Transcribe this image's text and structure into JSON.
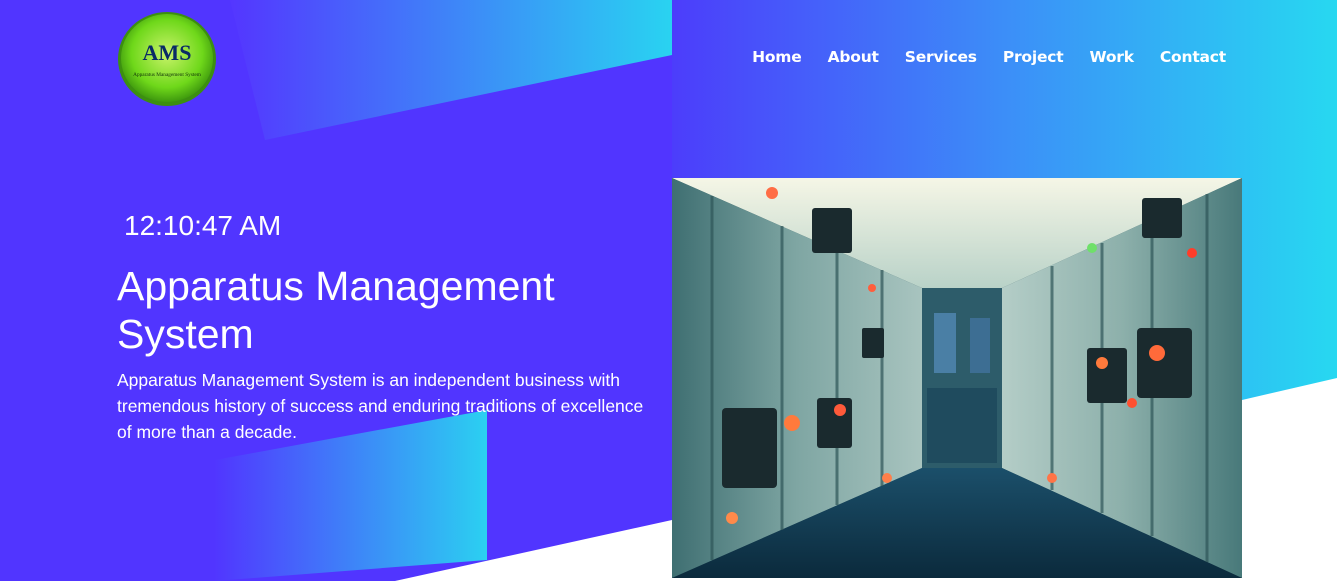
{
  "logo": {
    "letters": "AMS",
    "caption": "Apparatus Management System"
  },
  "nav": {
    "items": [
      {
        "label": "Home"
      },
      {
        "label": "About"
      },
      {
        "label": "Services"
      },
      {
        "label": "Project"
      },
      {
        "label": "Work"
      },
      {
        "label": "Contact"
      }
    ]
  },
  "hero": {
    "clock": "12:10:47 AM",
    "title": "Apparatus Management System",
    "description": "Apparatus Management System is an independent business with tremendous history of success and enduring traditions of excellence of more than a decade."
  },
  "colors": {
    "primary": "#5135ff",
    "accent": "#26d6f0",
    "logo_green": "#6fd81a"
  }
}
